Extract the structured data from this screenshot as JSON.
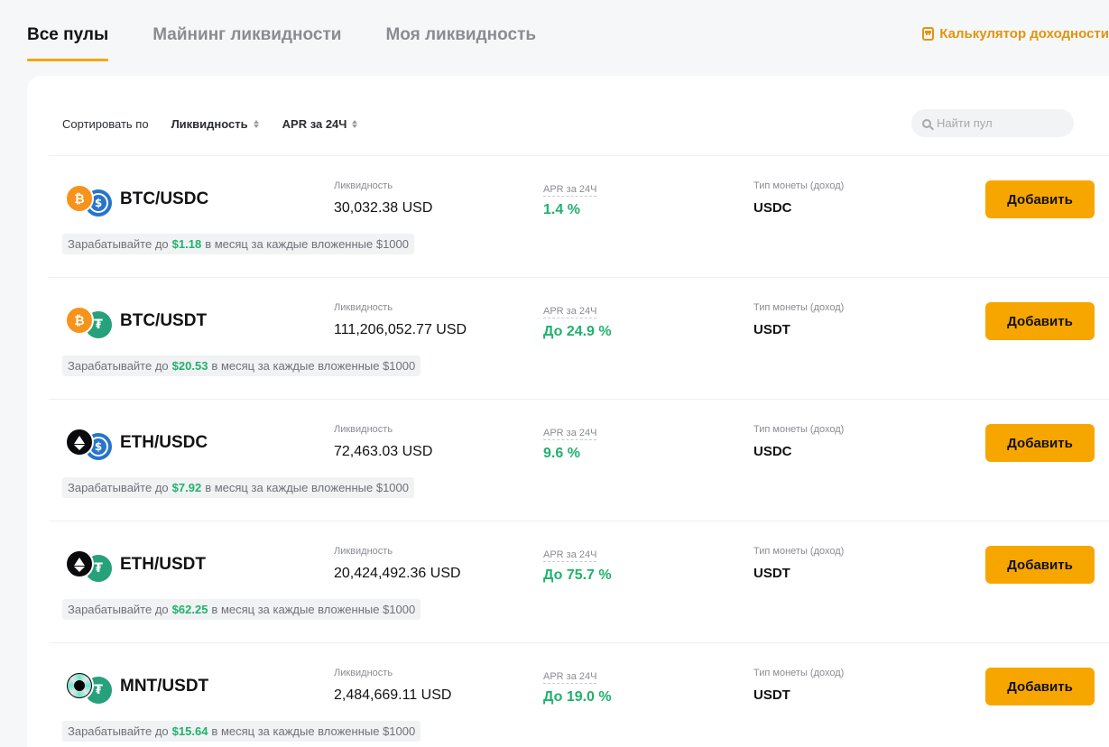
{
  "tabs": [
    {
      "label": "Все пулы",
      "active": true
    },
    {
      "label": "Майнинг ликвидности",
      "active": false
    },
    {
      "label": "Моя ликвидность",
      "active": false
    }
  ],
  "calculator_link": "Калькулятор доходности",
  "sort": {
    "label": "Сортировать по",
    "options": [
      "Ликвидность",
      "APR за 24Ч"
    ]
  },
  "search": {
    "placeholder": "Найти пул",
    "value": ""
  },
  "column_labels": {
    "liquidity": "Ликвидность",
    "apr": "APR за 24Ч",
    "coin_type": "Тип монеты (доход)"
  },
  "earn_text": {
    "prefix": "Зарабатывайте до",
    "suffix": "в месяц за каждые вложенные $1000"
  },
  "add_button_label": "Добавить",
  "pools": [
    {
      "base_icon": "btc-icon",
      "quote_icon": "usdc-icon",
      "pair": "BTC/USDC",
      "liquidity": "30,032.38 USD",
      "apr": "1.4 %",
      "coin_type": "USDC",
      "earn_amount": "$1.18"
    },
    {
      "base_icon": "btc-icon",
      "quote_icon": "usdt-icon",
      "pair": "BTC/USDT",
      "liquidity": "111,206,052.77 USD",
      "apr": "До 24.9 %",
      "coin_type": "USDT",
      "earn_amount": "$20.53"
    },
    {
      "base_icon": "eth-icon",
      "quote_icon": "usdc-icon",
      "pair": "ETH/USDC",
      "liquidity": "72,463.03 USD",
      "apr": "9.6 %",
      "coin_type": "USDC",
      "earn_amount": "$7.92"
    },
    {
      "base_icon": "eth-icon",
      "quote_icon": "usdt-icon",
      "pair": "ETH/USDT",
      "liquidity": "20,424,492.36 USD",
      "apr": "До 75.7 %",
      "coin_type": "USDT",
      "earn_amount": "$62.25"
    },
    {
      "base_icon": "mnt-icon",
      "quote_icon": "usdt-icon",
      "pair": "MNT/USDT",
      "liquidity": "2,484,669.11 USD",
      "apr": "До 19.0 %",
      "coin_type": "USDT",
      "earn_amount": "$15.64"
    }
  ],
  "colors": {
    "accent": "#f7a600",
    "link": "#e2940b",
    "positive": "#20b26c",
    "btc": "#f7931a",
    "eth": "#0b0b0d",
    "usdc": "#2775ca",
    "usdt": "#26a17b"
  }
}
